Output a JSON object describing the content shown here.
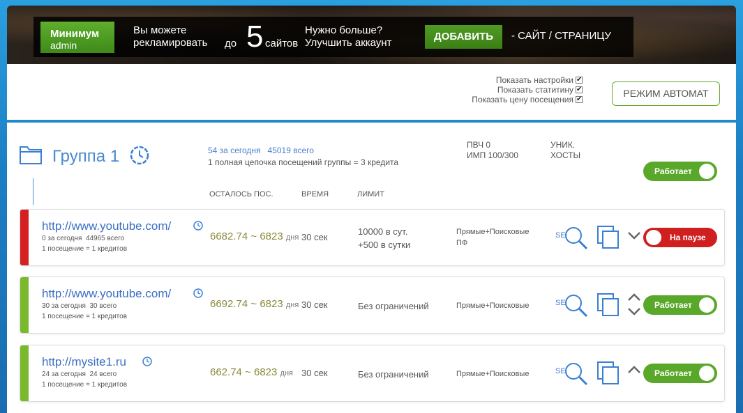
{
  "banner": {
    "plan_name": "Минимум",
    "plan_user": "admin",
    "promo_line1": "Вы можете",
    "promo_line2": "рекламировать",
    "up_to": "до",
    "sites_count": "5",
    "sites_label": "сайтов",
    "need_more_line1": "Нужно больше?",
    "need_more_line2": "Улучшить аккаунт",
    "add_button": "ДОБАВИТЬ",
    "add_suffix": "- САЙТ / СТРАНИЦУ"
  },
  "settings": {
    "show_settings": "Показать настройки",
    "show_stats": "Показать статитину",
    "show_price": "Показать цену посещения",
    "auto_mode_button": "РЕЖИМ АВТОМАТ"
  },
  "group": {
    "title": "Группа 1",
    "today": "54 за сегодня",
    "total": "45019 всего",
    "chain": "1 полная цепочка посещений группы = 3 кредита",
    "pvch": "ПВЧ 0",
    "imp": "ИМП 100/300",
    "uniq_line1": "УНИК.",
    "uniq_line2": "ХОСТЫ",
    "status": "Работает"
  },
  "columns": {
    "remaining": "ОСТАЛОСЬ ПОС.",
    "time": "ВРЕМЯ",
    "limit": "ЛИМИТ"
  },
  "rows": [
    {
      "url": "http://www.youtube.com/",
      "today": "0 за сегодня",
      "total": "44965 всего",
      "cost": "1 посещение = 1 кредитов",
      "remaining": "6682.74",
      "days": "~ 6823",
      "days_unit": "дня",
      "time": "30 сек",
      "limit_line1": "10000 в сут.",
      "limit_line2": "+500 в сутки",
      "search_line1": "Прямые+Поисковые",
      "search_line2": "ПФ",
      "seo": "SE",
      "status": "На паузе",
      "bar_color": "#d42020"
    },
    {
      "url": "http://www.youtube.com/",
      "today": "30 за сегодня",
      "total": "30 всего",
      "cost": "1 посещение = 1 кредитов",
      "remaining": "6692.74",
      "days": "~ 6823",
      "days_unit": "дня",
      "time": "30 сек",
      "limit_line1": "Без ограничений",
      "limit_line2": "",
      "search_line1": "Прямые+Поисковые",
      "search_line2": "",
      "seo": "SE",
      "status": "Работает",
      "bar_color": "#7ab82e"
    },
    {
      "url": "http://mysite1.ru",
      "today": "24 за сегодня",
      "total": "24 всего",
      "cost": "1 посещение = 1 кредитов",
      "remaining": "662.74",
      "days": "~ 6823",
      "days_unit": "дня",
      "time": "30 сек",
      "limit_line1": "Без ограничений",
      "limit_line2": "",
      "search_line1": "Прямые+Поисковые",
      "search_line2": "",
      "seo": "SE",
      "status": "Работает",
      "bar_color": "#7ab82e"
    }
  ]
}
